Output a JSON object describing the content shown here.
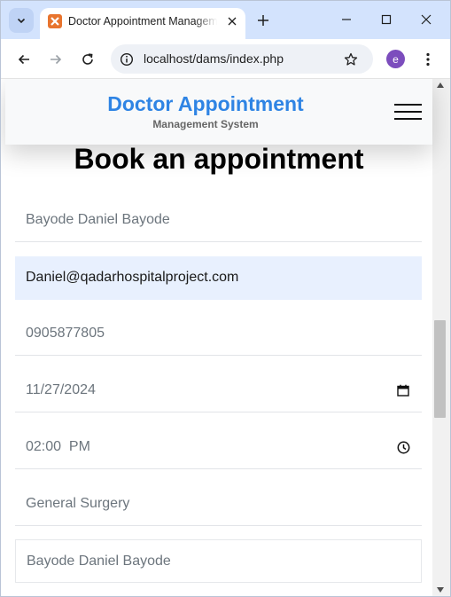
{
  "browser": {
    "tab_title": "Doctor Appointment Management System",
    "url": "localhost/dams/index.php",
    "profile_initial": "e",
    "accent_color": "#d3e3fd",
    "icons": [
      "tab-list-icon",
      "xampp-favicon",
      "close-icon",
      "plus-icon",
      "minimize-icon",
      "maximize-icon",
      "close-window-icon",
      "back-icon",
      "forward-icon",
      "reload-icon",
      "site-info-icon",
      "star-icon",
      "kebab-menu-icon"
    ]
  },
  "header": {
    "brand_title": "Doctor Appointment",
    "brand_subtitle": "Management System",
    "brand_color": "#2f84e4",
    "menu_icon": "hamburger-icon"
  },
  "form": {
    "heading": "Book an appointment",
    "fields": [
      {
        "name": "full-name",
        "value": "Bayode Daniel Bayode"
      },
      {
        "name": "email",
        "value": "Daniel@qadarhospitalproject.com"
      },
      {
        "name": "phone",
        "value": "0905877805"
      },
      {
        "name": "date",
        "value": "11/27/2024",
        "icon": "calendar-icon"
      },
      {
        "name": "time",
        "value": "02:00  PM",
        "icon": "clock-icon"
      },
      {
        "name": "specialization",
        "value": "General Surgery"
      },
      {
        "name": "doctor",
        "value": "Bayode Daniel Bayode"
      }
    ]
  }
}
